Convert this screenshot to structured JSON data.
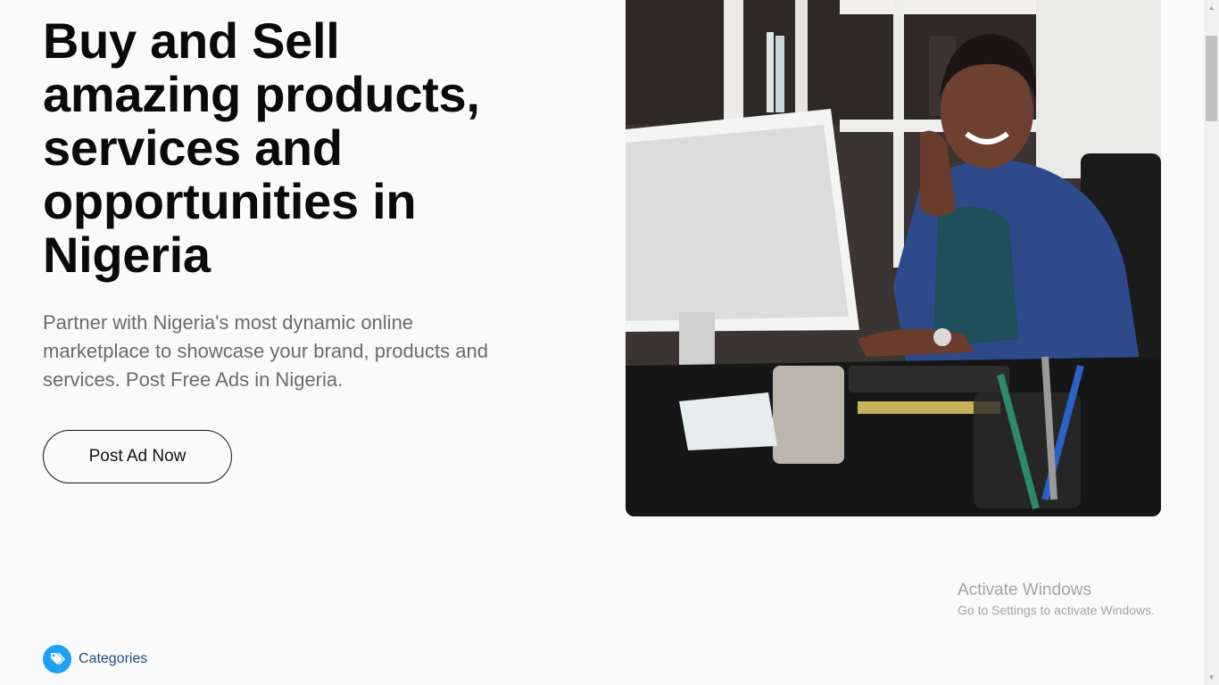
{
  "hero": {
    "title": "Buy and Sell amazing products, services and opportunities in Nigeria",
    "subtitle": "Partner with Nigeria's most dynamic online marketplace to showcase your brand, products and services. Post Free Ads in Nigeria.",
    "cta_label": "Post Ad Now",
    "image_icon": "photo-businesswoman-at-desk"
  },
  "categories": {
    "label": "Categories",
    "icon": "tag-icon",
    "icon_color": "#1ea1f2"
  },
  "watermark": {
    "title": "Activate Windows",
    "subtitle": "Go to Settings to activate Windows."
  },
  "colors": {
    "background": "#fafafa",
    "heading": "#0a0a0a",
    "body_text": "#6b6b6b",
    "link": "#1d4f7a"
  }
}
